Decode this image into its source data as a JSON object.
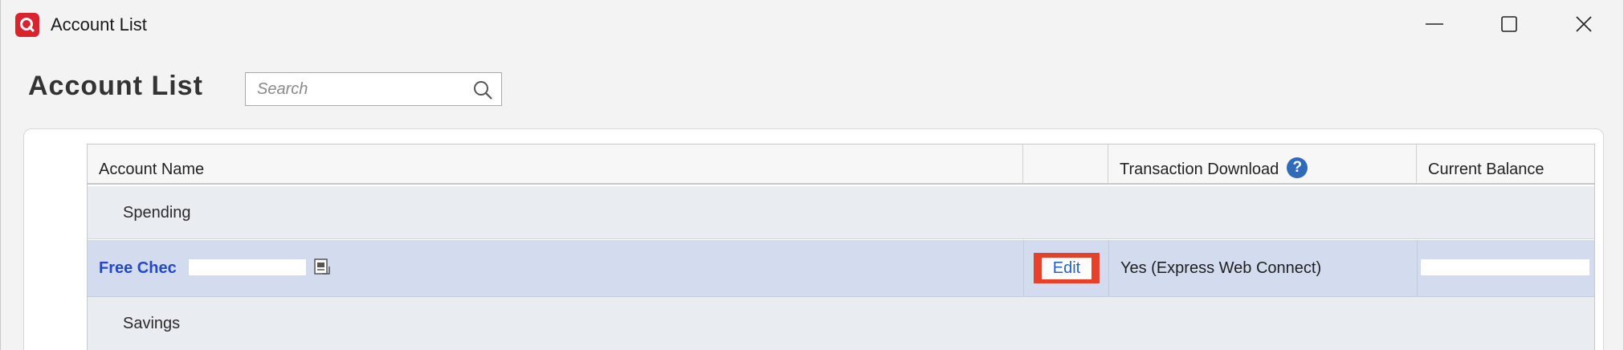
{
  "window": {
    "title": "Account List",
    "controls": [
      "minimize",
      "maximize",
      "close"
    ]
  },
  "page": {
    "title": "Account List",
    "search": {
      "placeholder": "Search",
      "value": ""
    }
  },
  "table": {
    "columns": [
      "Account Name",
      "",
      "Transaction Download",
      "Current Balance"
    ],
    "groups": [
      {
        "label": "Spending",
        "accounts": [
          {
            "name": "Free Chec",
            "edit_label": "Edit",
            "download_status": "Yes (Express Web Connect)"
          }
        ]
      },
      {
        "label": "Savings",
        "accounts": []
      }
    ]
  },
  "colors": {
    "brand": "#d8242f",
    "link": "#2349c4",
    "selected_row": "#d3dbef",
    "highlight_box": "#e8402a",
    "help_icon": "#2f6bb8"
  }
}
